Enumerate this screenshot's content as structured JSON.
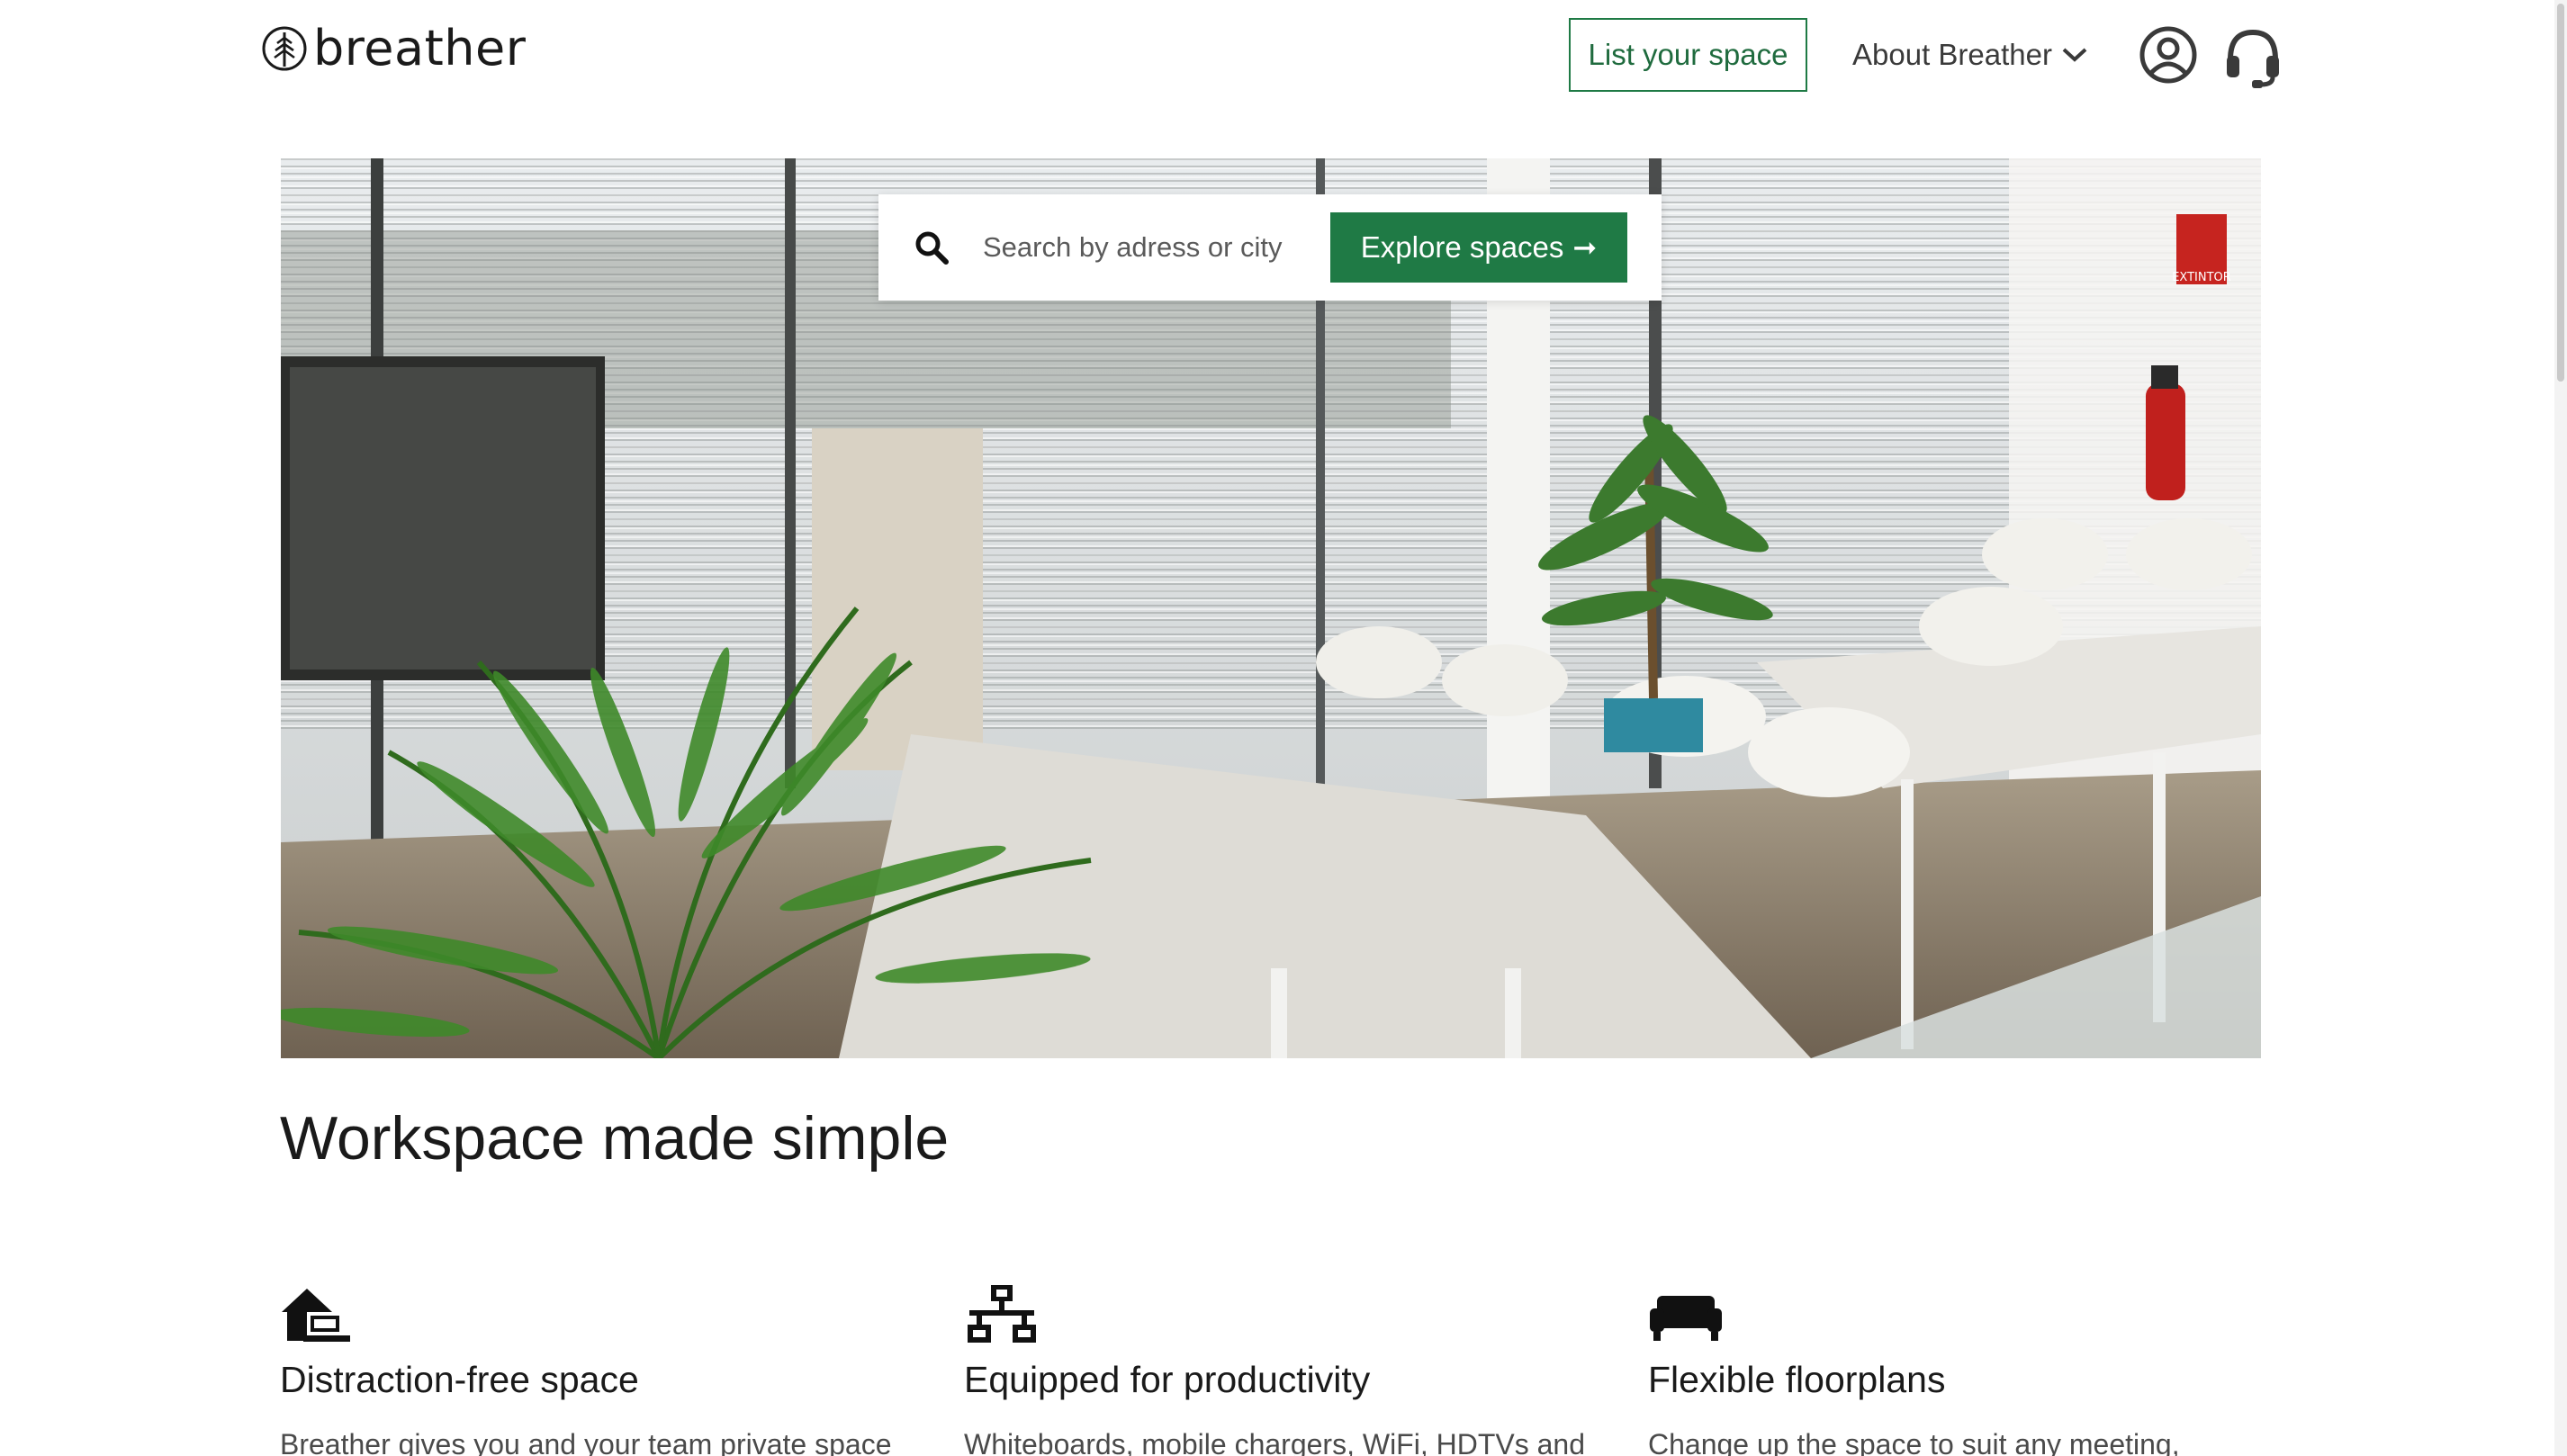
{
  "brand": {
    "name": "breather"
  },
  "header": {
    "list_space_label": "List your space",
    "about_label": "About Breather",
    "account_icon": "user-circle-icon",
    "support_icon": "headset-icon"
  },
  "hero": {
    "search_placeholder": "Search by adress or city",
    "search_value": "",
    "explore_label": "Explore spaces",
    "explore_arrow": "➞",
    "sign_text": "EXTINTOR"
  },
  "section": {
    "title": "Workspace made simple",
    "features": [
      {
        "icon": "house-laptop-icon",
        "title": "Distraction-free space",
        "text": "Breather gives you and your team private space"
      },
      {
        "icon": "network-icon",
        "title": "Equipped for productivity",
        "text": "Whiteboards, mobile chargers, WiFi, HDTVs and"
      },
      {
        "icon": "couch-icon",
        "title": "Flexible floorplans",
        "text": "Change up the space to suit any meeting,"
      }
    ]
  },
  "colors": {
    "brand_green": "#1f7a45",
    "text": "#1a1a1a",
    "muted": "#4a4a4a"
  }
}
